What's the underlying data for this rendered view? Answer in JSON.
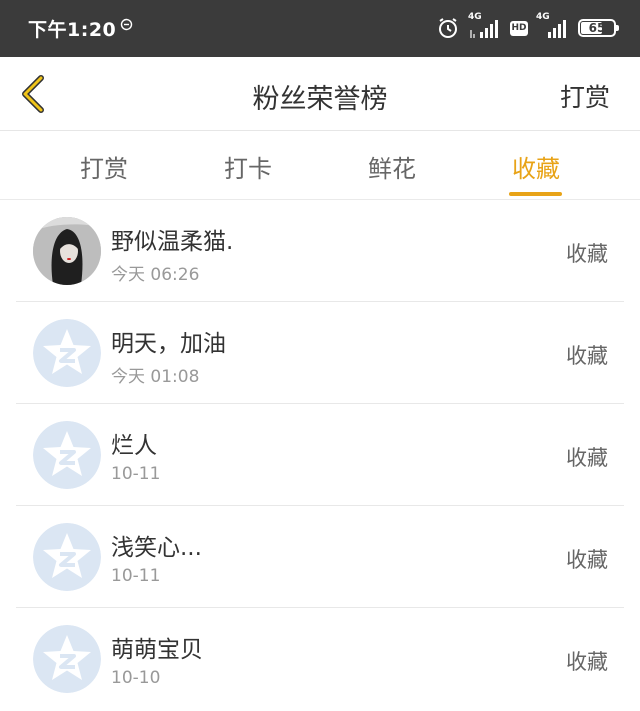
{
  "status_bar": {
    "time": "下午1:20",
    "network1": "4G",
    "hd": "HD",
    "network2": "4G",
    "battery": "65",
    "icons": [
      "alarm-icon",
      "signal-icon",
      "hd-icon",
      "signal-icon",
      "battery-icon"
    ]
  },
  "nav": {
    "title": "粉丝荣誉榜",
    "right_label": "打赏",
    "back_icon": "chevron-left-icon",
    "accent_color": "#e8a317"
  },
  "tabs": [
    {
      "label": "打赏"
    },
    {
      "label": "打卡"
    },
    {
      "label": "鲜花"
    },
    {
      "label": "收藏",
      "active": true
    }
  ],
  "list": [
    {
      "name": "野似温柔猫.",
      "time": "今天 06:26",
      "action": "收藏",
      "avatar": "photo-avatar"
    },
    {
      "name": "明天，加油",
      "time": "今天 01:08",
      "action": "收藏",
      "avatar": "default-star-avatar"
    },
    {
      "name": "烂人",
      "time": "10-11",
      "action": "收藏",
      "avatar": "default-star-avatar"
    },
    {
      "name": "浅笑心...",
      "time": "10-11",
      "action": "收藏",
      "avatar": "default-star-avatar"
    },
    {
      "name": "萌萌宝贝",
      "time": "10-10",
      "action": "收藏",
      "avatar": "default-star-avatar"
    }
  ]
}
